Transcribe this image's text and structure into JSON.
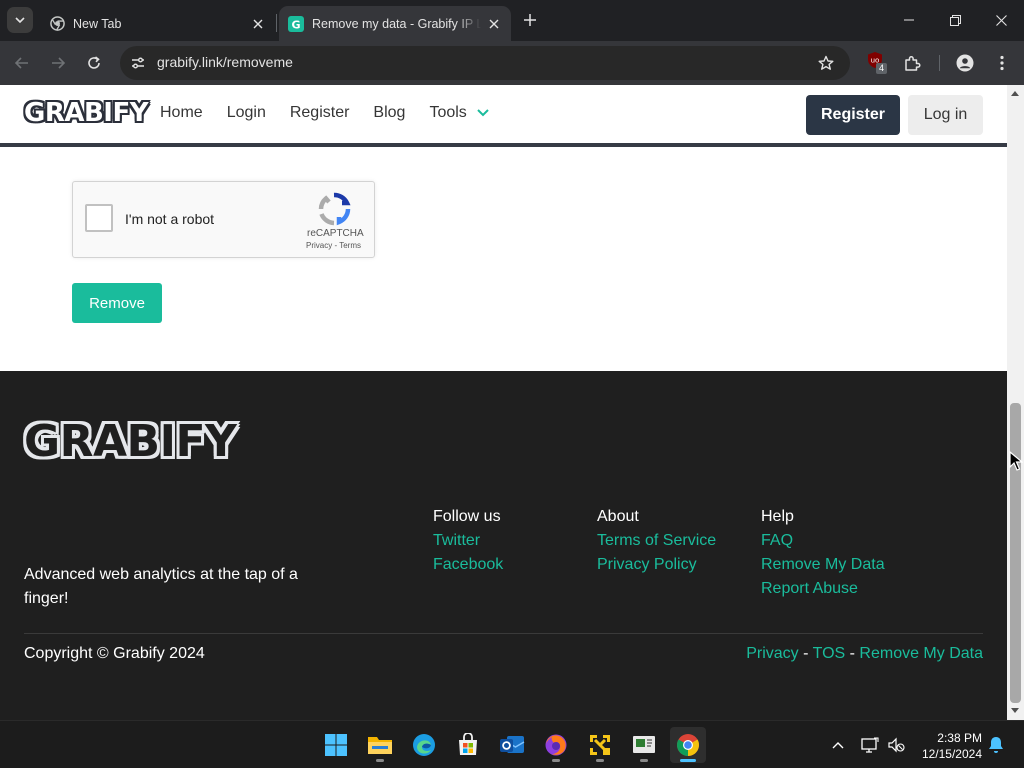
{
  "browser": {
    "tabs": [
      {
        "title": "New Tab",
        "active": false
      },
      {
        "title": "Remove my data - Grabify IP Lo",
        "active": true
      }
    ],
    "url": "grabify.link/removeme",
    "extension_badge": "4"
  },
  "navbar": {
    "logo": "GRABIFY",
    "links": [
      "Home",
      "Login",
      "Register",
      "Blog"
    ],
    "tools_label": "Tools",
    "register_button": "Register",
    "login_button": "Log in"
  },
  "recaptcha": {
    "label": "I'm not a robot",
    "brand": "reCAPTCHA",
    "privacy": "Privacy",
    "separator": " - ",
    "terms": "Terms"
  },
  "form": {
    "remove_button": "Remove"
  },
  "footer": {
    "logo": "GRABIFY",
    "tagline": "Advanced web analytics at the tap of a finger!",
    "follow": {
      "heading": "Follow us",
      "links": [
        "Twitter",
        "Facebook"
      ]
    },
    "about": {
      "heading": "About",
      "links": [
        "Terms of Service",
        "Privacy Policy"
      ]
    },
    "help": {
      "heading": "Help",
      "links": [
        "FAQ",
        "Remove My Data",
        "Report Abuse"
      ]
    },
    "copyright": "Copyright © Grabify 2024",
    "bottom_links": [
      "Privacy",
      "TOS",
      "Remove My Data"
    ],
    "bottom_sep": " - "
  },
  "taskbar": {
    "apps": [
      "start",
      "file-explorer",
      "edge",
      "microsoft-store",
      "outlook",
      "firefox",
      "app-yellow",
      "app-slides",
      "chrome"
    ],
    "time": "2:38 PM",
    "date": "12/15/2024"
  },
  "colors": {
    "accent": "#1abc9c",
    "navy": "#2b3645",
    "footer_bg": "#1f1f1f"
  }
}
